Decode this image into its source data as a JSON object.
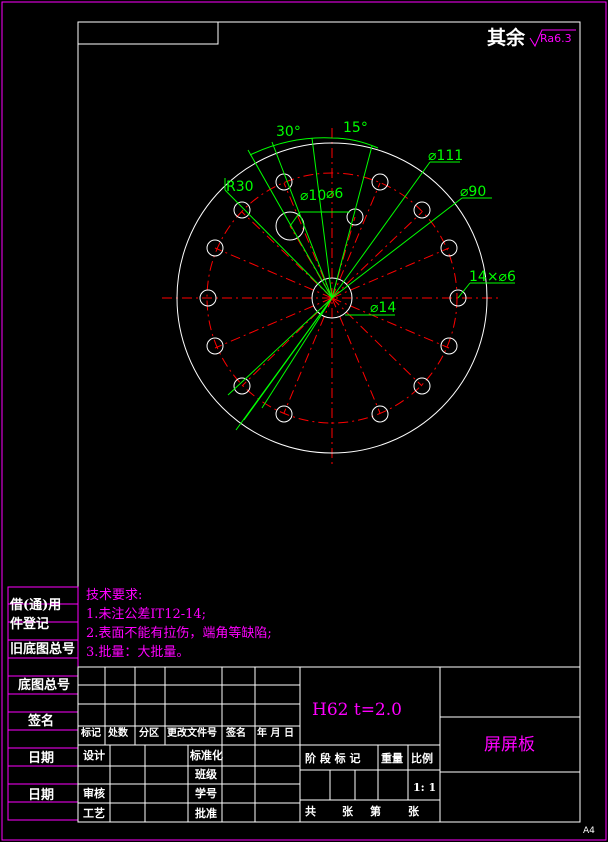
{
  "surface_finish": {
    "prefix": "其余",
    "value": "Ra6.3"
  },
  "dimensions": {
    "angle_30": "30°",
    "angle_15": "15°",
    "dia_111": "⌀111",
    "dia_90": "⌀90",
    "radius_30": "R30",
    "dia_10": "⌀10",
    "dia_6": "⌀6",
    "holes": "14×⌀6",
    "dia_14": "⌀14"
  },
  "tech_requirements": {
    "heading": "技术要求:",
    "items": [
      "1.未注公差IT12-14;",
      "2.表面不能有拉伤，端角等缺陷;",
      "3.批量：大批量。"
    ]
  },
  "side_stamp": {
    "used_on": "借(通)用",
    "record": "件登记",
    "old_drawing_no": "旧底图总号",
    "base_drawing_no": "底图总号",
    "signature": "签名",
    "date1": "日期",
    "date2": "日期"
  },
  "title_block": {
    "material": "H62   t=2.0",
    "part_name": "屏屏板",
    "rev_headers": [
      "标记",
      "处数",
      "分区",
      "更改文件号",
      "签名",
      "年 月 日"
    ],
    "design": "设计",
    "standardize": "标准化",
    "class": "班级",
    "review": "审核",
    "student_no": "学号",
    "process": "工艺",
    "approve": "批准",
    "stage_mark": "阶 段 标 记",
    "weight": "重量",
    "scale_label": "比例",
    "scale_value": "1: 1",
    "sheets": [
      "共",
      "张",
      "第",
      "张"
    ]
  },
  "sheet_size": "A4",
  "colors": {
    "border": "#ff00ff",
    "drawing": "#ffffff",
    "center_lines": "#ff0000",
    "dimension": "#00ff00",
    "text_magenta": "#ff00ff",
    "text_green": "#00ff00"
  }
}
